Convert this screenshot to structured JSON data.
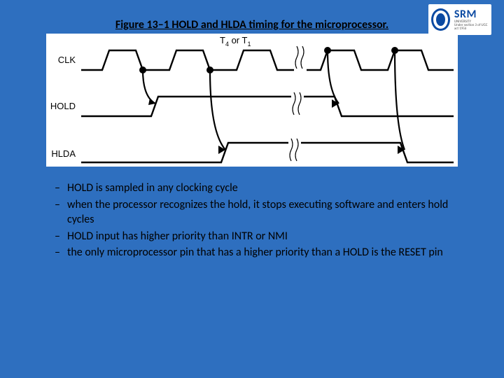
{
  "logo": {
    "brand": "SRM",
    "sub1": "UNIVERSITY",
    "sub2": "Under section 3 of UGC act 1956"
  },
  "caption": "Figure 13–1  HOLD and HLDA timing for the microprocessor.",
  "diagram": {
    "top_label_left": "T",
    "top_label_4": "4",
    "top_label_or": " or ",
    "top_label_T2": "T",
    "top_label_1": "1",
    "signals": [
      "CLK",
      "HOLD",
      "HLDA"
    ]
  },
  "bullets": [
    "HOLD is sampled in any clocking cycle",
    "when the processor recognizes the hold, it stops executing software and enters hold cycles",
    "HOLD input has higher priority than INTR or NMI",
    "the only microprocessor pin that has a higher priority than a HOLD is the RESET pin"
  ],
  "chart_data": {
    "type": "table",
    "title": "HOLD and HLDA timing for the microprocessor",
    "time_label": "T4 or T1",
    "series": [
      {
        "name": "CLK",
        "values": [
          "toggles each half-cycle (square wave)"
        ]
      },
      {
        "name": "HOLD",
        "values": [
          "low",
          "rises at first CLK falling edge",
          "high",
          "falls before fourth CLK rising edge",
          "low"
        ]
      },
      {
        "name": "HLDA",
        "values": [
          "low",
          "rises one CLK after HOLD rise",
          "high",
          "falls one CLK after HOLD fall",
          "low"
        ]
      }
    ],
    "dependencies": [
      "HOLD sampled on CLK falling edge",
      "HLDA asserted after HOLD recognized",
      "HLDA deasserted after HOLD deasserted"
    ]
  }
}
